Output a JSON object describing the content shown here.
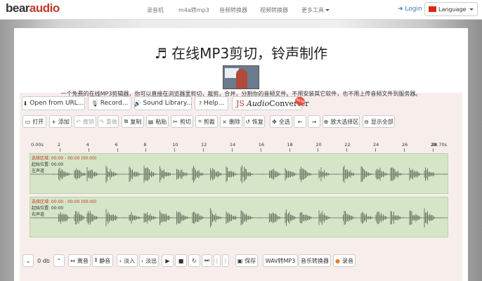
{
  "logo": {
    "part1": "bear",
    "part2": "audio"
  },
  "nav": {
    "items": [
      {
        "label": "录音机"
      },
      {
        "label": "m4a转mp3"
      },
      {
        "label": "音频转换器"
      },
      {
        "label": "视频转换器"
      },
      {
        "label": "更多工具"
      }
    ],
    "login_label": "Login",
    "language_label": "Language"
  },
  "hero": {
    "title": "在线MP3剪切，铃声制作",
    "description": "一个免费的在线MP3剪辑器，你可以直接在浏览器里剪切，裁剪，合并，分割你的音频文件。不用安装其它软件，也不用上传音频文件到服务器。"
  },
  "top_buttons": [
    {
      "label": "Open from URL..."
    },
    {
      "label": "Record..."
    },
    {
      "label": "Sound Library..."
    },
    {
      "label": "Help..."
    }
  ],
  "jsac": {
    "js": "JS",
    "audio": "Audio",
    "converter": "Converter",
    "badge": "NEW"
  },
  "toolbar": [
    {
      "label": "打开"
    },
    {
      "label": "添加"
    },
    {
      "label": "撤销"
    },
    {
      "label": "重做"
    },
    {
      "label": "复制"
    },
    {
      "label": "粘贴"
    },
    {
      "label": "剪切"
    },
    {
      "label": "剪裁"
    },
    {
      "label": "删除"
    },
    {
      "label": "恢复"
    },
    {
      "label": "全选"
    },
    {
      "label": "放大选择区"
    },
    {
      "label": "显示全部"
    }
  ],
  "timeline": {
    "start": "0.00s",
    "end": "28.70s",
    "ticks": [
      "2",
      "4",
      "6",
      "8",
      "10",
      "12",
      "14",
      "16",
      "18",
      "20",
      "22",
      "24",
      "26",
      "28"
    ]
  },
  "tracks": [
    {
      "selection": "选择区域: 00:00 - 00:00 (00:00)",
      "cursor": "起始位置: 00:00",
      "channel": "左声道"
    },
    {
      "selection": "选择区域: 00:00 - 00:00 (00:00)",
      "cursor": "起始位置: 00:00",
      "channel": "右声道"
    }
  ],
  "bottom_toolbar": {
    "db_value": "0 db",
    "buttons": [
      {
        "label": "离音"
      },
      {
        "label": "静音"
      },
      {
        "label": "淡入"
      },
      {
        "label": "淡出"
      },
      {
        "label": "保存"
      },
      {
        "label": "WAV转MP3"
      },
      {
        "label": "音乐转换器"
      },
      {
        "label": "录音"
      }
    ]
  },
  "colors": {
    "brand_red": "#c0392b",
    "link_blue": "#337ab7",
    "track_bg": "#d5e6c8",
    "wave": "#6e7a68"
  }
}
